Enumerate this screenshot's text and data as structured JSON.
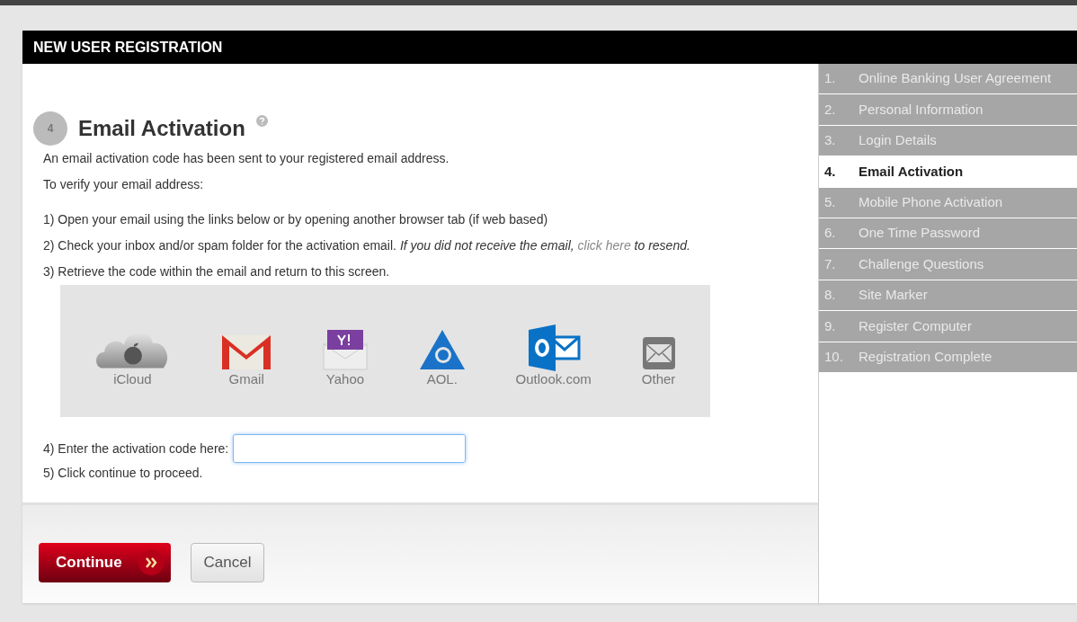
{
  "header": {
    "title": "NEW USER REGISTRATION"
  },
  "step": {
    "number": "4",
    "title": "Email Activation"
  },
  "intro": [
    "An email activation code has been sent to your registered email address.",
    "To verify your email address:"
  ],
  "instructions": [
    {
      "text": "1) Open your email using the links below or by opening another browser tab (if web based)"
    },
    {
      "text": "2) Check your inbox and/or spam folder for the activation email.",
      "note": "If you did not receive the email,",
      "link": "click here",
      "note_end": "to resend."
    },
    {
      "text": "3) Retrieve the code within the email and return to this screen."
    }
  ],
  "providers": [
    {
      "kind": "icloud",
      "label": "iCloud"
    },
    {
      "kind": "gmail",
      "label": "Gmail"
    },
    {
      "kind": "yahoo",
      "label": "Yahoo"
    },
    {
      "kind": "aol",
      "label": "AOL."
    },
    {
      "kind": "outlook",
      "label": "Outlook.com"
    },
    {
      "kind": "other",
      "label": "Other"
    }
  ],
  "code_label": "4) Enter the activation code here:",
  "proceed": "5) Click continue to proceed.",
  "buttons": {
    "continue": "Continue",
    "cancel": "Cancel"
  },
  "steps": [
    {
      "number": "1.",
      "label": "Online Banking User Agreement",
      "selected": false
    },
    {
      "number": "2.",
      "label": "Personal Information",
      "selected": false
    },
    {
      "number": "3.",
      "label": "Login Details",
      "selected": false
    },
    {
      "number": "4.",
      "label": "Email Activation",
      "selected": true
    },
    {
      "number": "5.",
      "label": "Mobile Phone Activation",
      "selected": false
    },
    {
      "number": "6.",
      "label": "One Time Password",
      "selected": false
    },
    {
      "number": "7.",
      "label": "Challenge Questions",
      "selected": false
    },
    {
      "number": "8.",
      "label": "Site Marker",
      "selected": false
    },
    {
      "number": "9.",
      "label": "Register Computer",
      "selected": false
    },
    {
      "number": "10.",
      "label": "Registration Complete",
      "selected": false
    }
  ]
}
